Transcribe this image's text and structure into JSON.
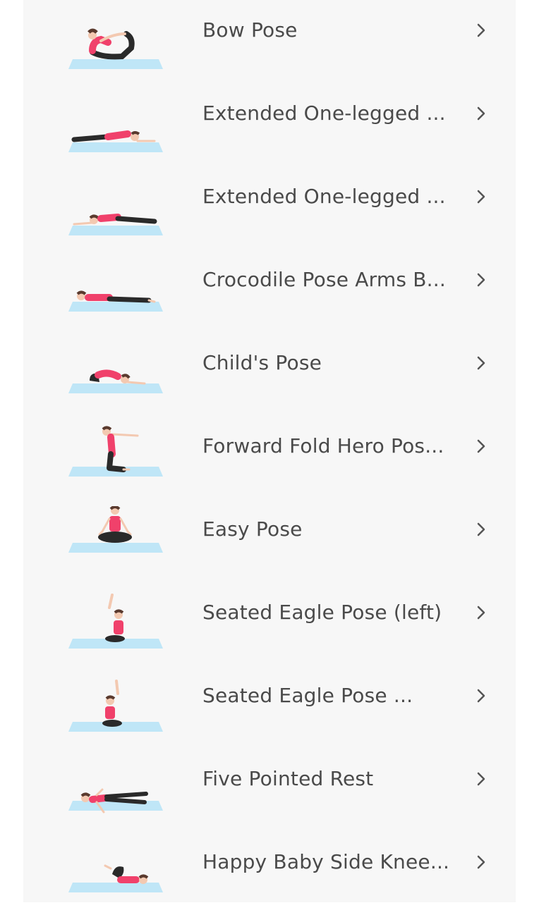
{
  "poses": [
    {
      "name": "Bow Pose",
      "icon": "bow-pose-illustration"
    },
    {
      "name": "Extended One-legged ...",
      "icon": "extended-one-legged-illustration"
    },
    {
      "name": "Extended One-legged ...",
      "icon": "extended-one-legged-illustration"
    },
    {
      "name": "Crocodile Pose Arms B...",
      "icon": "crocodile-pose-illustration"
    },
    {
      "name": "Child's Pose",
      "icon": "childs-pose-illustration"
    },
    {
      "name": "Forward Fold Hero Pos...",
      "icon": "forward-fold-hero-illustration"
    },
    {
      "name": "Easy Pose",
      "icon": "easy-pose-illustration"
    },
    {
      "name": "Seated Eagle Pose (left)",
      "icon": "seated-eagle-illustration"
    },
    {
      "name": "Seated Eagle Pose ...",
      "icon": "seated-eagle-illustration"
    },
    {
      "name": "Five Pointed Rest",
      "icon": "five-pointed-rest-illustration"
    },
    {
      "name": "Happy Baby Side Knee...",
      "icon": "happy-baby-illustration"
    }
  ],
  "colors": {
    "mat": "#bfe6f7",
    "top": "#f0416b",
    "pants": "#2a2a2a",
    "skin": "#f3c9b1",
    "hair": "#5a3a2e",
    "chevron": "#555555",
    "text": "#4a4a4a",
    "panel": "#f7f7f7"
  }
}
